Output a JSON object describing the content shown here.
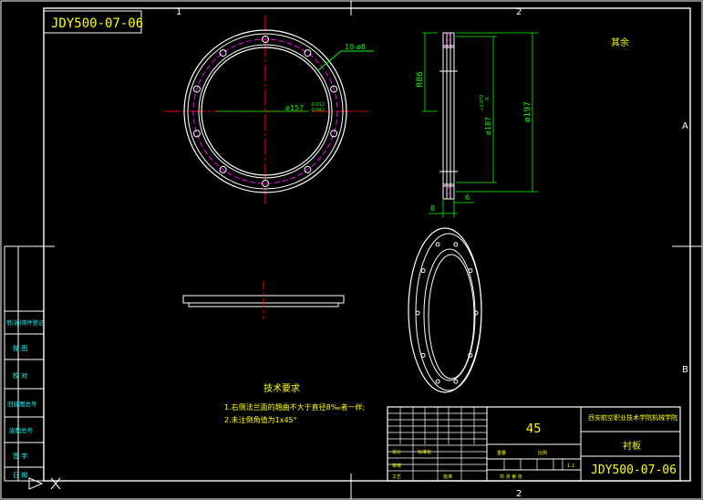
{
  "drawing_number": "JDY500-07-06",
  "zone_numbers": {
    "top_1": "1",
    "top_2": "2",
    "bottom_2": "2",
    "right_a": "A",
    "right_b": "B"
  },
  "top_view": {
    "hole_callout": "10-ø8",
    "pitch_diameter": "ø157",
    "tolerance_upper": "-0.012",
    "tolerance_lower": "-0.042"
  },
  "side_view": {
    "radius_label": "R86",
    "inner_diameter": "ø187",
    "inner_tol_upper": "+0.072",
    "inner_tol_lower": "0",
    "outer_diameter": "ø197",
    "dim_6": "6",
    "dim_b": "8"
  },
  "unlabeled_note": "其余",
  "technical_requirements": {
    "title": "技术要求",
    "items": [
      "1.右侧法兰面的翘曲不大于直径8‰者一样;",
      "2.未注倒角值为1x45°"
    ]
  },
  "left_column": {
    "labels": [
      "借(通)用件登记",
      "描 图",
      "校 对",
      "旧底图总号",
      "底图总号",
      "签 字",
      "日 期"
    ]
  },
  "title_block": {
    "scale_value": "45",
    "institute": "西安航空职业技术学院机械学院",
    "part_name": "衬板",
    "drawing_number": "JDY500-07-06",
    "small_labels": [
      "设计",
      "标准化",
      "审核",
      "工艺",
      "批准"
    ],
    "weight_label": "重量",
    "ratio_label": "比例",
    "ratio_value": "1:2",
    "sheet_label": "共 张 第 张"
  },
  "colors": {
    "frame": "#ffffff",
    "text": "#ffff00",
    "dimension": "#00ff00",
    "centerline": "#ff0000",
    "hidden_circle": "#ff00ff",
    "labels": "#00ffff",
    "hatch": "#ff00ff"
  }
}
